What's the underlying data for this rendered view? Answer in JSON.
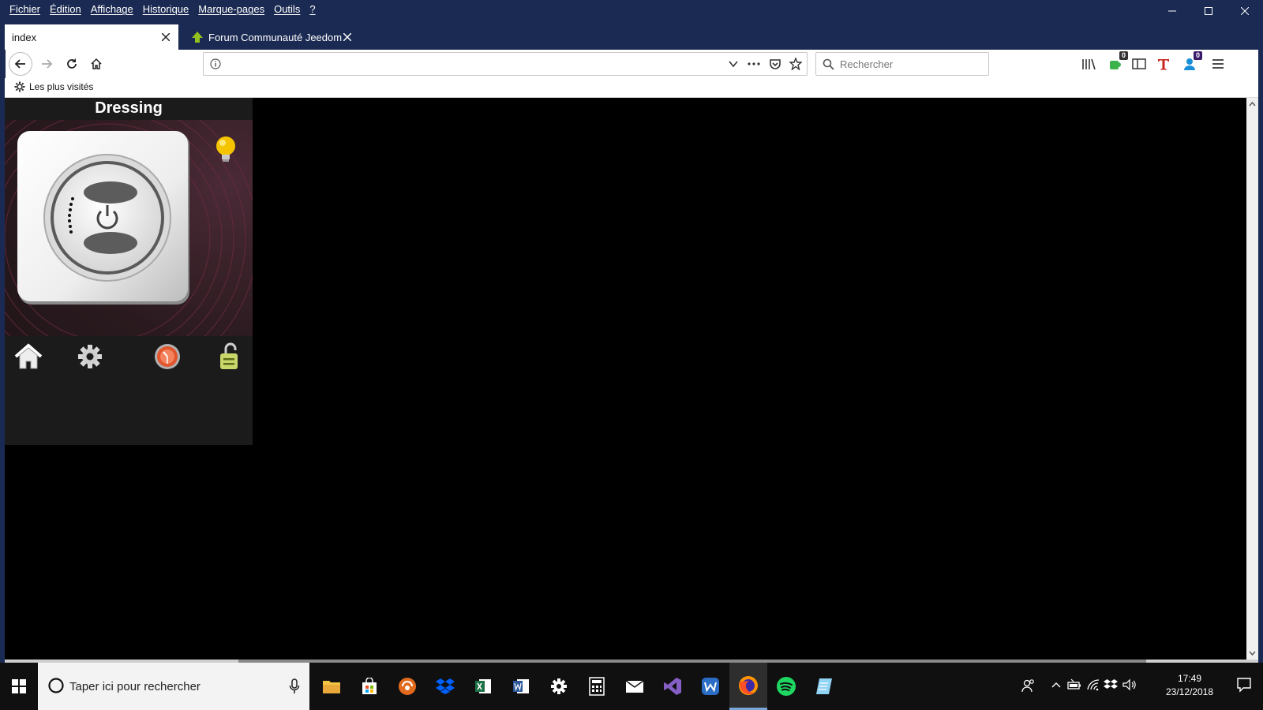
{
  "menubar": {
    "items": [
      "Fichier",
      "Édition",
      "Affichage",
      "Historique",
      "Marque-pages",
      "Outils",
      "?"
    ]
  },
  "tabs": [
    {
      "title": "index",
      "active": true
    },
    {
      "title": "Forum Communauté Jeedom",
      "active": false
    }
  ],
  "navbar": {
    "url": "",
    "search_placeholder": "Rechercher",
    "badges": {
      "extension1": "0",
      "extension2": "0"
    }
  },
  "bookmarks": {
    "items": [
      "Les plus visités"
    ]
  },
  "widget": {
    "title": "Dressing",
    "state": "on"
  },
  "taskbar": {
    "search_placeholder": "Taper ici pour rechercher",
    "time": "17:49",
    "date": "23/12/2018",
    "apps": [
      "file-explorer",
      "store",
      "cleaner",
      "dropbox",
      "excel",
      "word",
      "settings",
      "calculator",
      "mail",
      "visual-studio",
      "wamp",
      "firefox",
      "spotify",
      "notepad"
    ]
  },
  "colors": {
    "titlebar": "#1b2a52",
    "widget_bg": "#1b1b1b",
    "content_bg": "#000000"
  }
}
